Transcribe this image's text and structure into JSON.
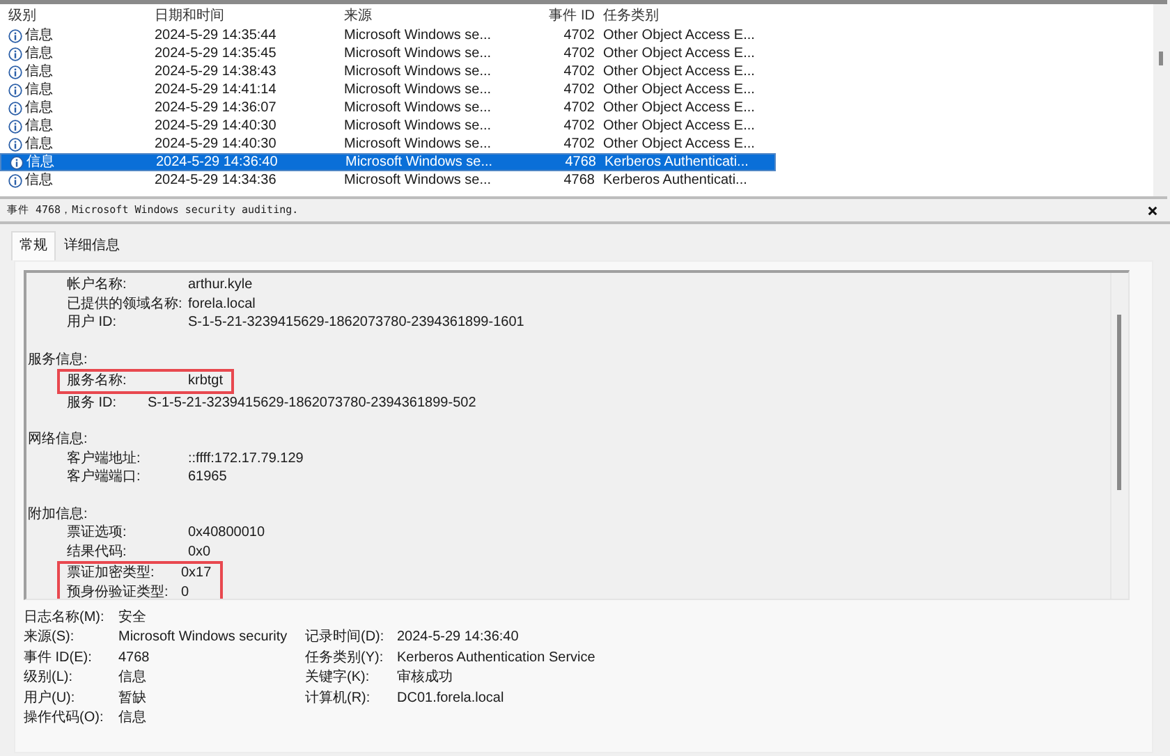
{
  "event_list": {
    "columns": [
      "级别",
      "日期和时间",
      "来源",
      "事件 ID",
      "任务类别"
    ],
    "rows": [
      {
        "level": "信息",
        "datetime": "2024-5-29 14:35:44",
        "source": "Microsoft Windows se...",
        "event_id": "4702",
        "task_category": "Other Object Access E...",
        "selected": false
      },
      {
        "level": "信息",
        "datetime": "2024-5-29 14:35:45",
        "source": "Microsoft Windows se...",
        "event_id": "4702",
        "task_category": "Other Object Access E...",
        "selected": false
      },
      {
        "level": "信息",
        "datetime": "2024-5-29 14:38:43",
        "source": "Microsoft Windows se...",
        "event_id": "4702",
        "task_category": "Other Object Access E...",
        "selected": false
      },
      {
        "level": "信息",
        "datetime": "2024-5-29 14:41:14",
        "source": "Microsoft Windows se...",
        "event_id": "4702",
        "task_category": "Other Object Access E...",
        "selected": false
      },
      {
        "level": "信息",
        "datetime": "2024-5-29 14:36:07",
        "source": "Microsoft Windows se...",
        "event_id": "4702",
        "task_category": "Other Object Access E...",
        "selected": false
      },
      {
        "level": "信息",
        "datetime": "2024-5-29 14:40:30",
        "source": "Microsoft Windows se...",
        "event_id": "4702",
        "task_category": "Other Object Access E...",
        "selected": false
      },
      {
        "level": "信息",
        "datetime": "2024-5-29 14:40:30",
        "source": "Microsoft Windows se...",
        "event_id": "4702",
        "task_category": "Other Object Access E...",
        "selected": false
      },
      {
        "level": "信息",
        "datetime": "2024-5-29 14:36:40",
        "source": "Microsoft Windows se...",
        "event_id": "4768",
        "task_category": "Kerberos Authenticati...",
        "selected": true
      },
      {
        "level": "信息",
        "datetime": "2024-5-29 14:34:36",
        "source": "Microsoft Windows se...",
        "event_id": "4768",
        "task_category": "Kerberos Authenticati...",
        "selected": false
      }
    ]
  },
  "detail": {
    "title": "事件 4768，Microsoft Windows security auditing.",
    "tabs": [
      {
        "label": "常规",
        "selected": true
      },
      {
        "label": "详细信息",
        "selected": false
      }
    ],
    "description": [
      {
        "fields": [
          {
            "label": "帐户名称:",
            "value": "arthur.kyle",
            "kind": "tabbed",
            "highlighted": false
          },
          {
            "label": "已提供的领域名称:",
            "value": "forela.local",
            "kind": "tabbed",
            "highlighted": false
          },
          {
            "label": "用户 ID:",
            "value": "S-1-5-21-3239415629-1862073780-2394361899-1601",
            "kind": "tabbed",
            "highlighted": false
          }
        ]
      },
      {
        "heading": "服务信息:",
        "fields": [
          {
            "label": "服务名称:",
            "value": "krbtgt",
            "kind": "tabbed",
            "highlighted": true
          },
          {
            "label": "服务 ID:",
            "value": "S-1-5-21-3239415629-1862073780-2394361899-502",
            "kind": "short",
            "highlighted": false
          }
        ]
      },
      {
        "heading": "网络信息:",
        "fields": [
          {
            "label": "客户端地址:",
            "value": "::ffff:172.17.79.129",
            "kind": "tabbed",
            "highlighted": false
          },
          {
            "label": "客户端端口:",
            "value": "61965",
            "kind": "tabbed",
            "highlighted": false
          }
        ]
      },
      {
        "heading": "附加信息:",
        "fields": [
          {
            "label": "票证选项:",
            "value": "0x40800010",
            "kind": "tabbed",
            "highlighted": false
          },
          {
            "label": "结果代码:",
            "value": "0x0",
            "kind": "tabbed",
            "highlighted": false
          },
          {
            "label": "票证加密类型:",
            "value": "0x17",
            "kind": "short",
            "highlighted": true
          },
          {
            "label": "预身份验证类型:",
            "value": "0",
            "kind": "short",
            "highlighted": true
          }
        ]
      }
    ],
    "properties": [
      [
        {
          "label": "日志名称(M):",
          "value": "安全"
        }
      ],
      [
        {
          "label": "来源(S):",
          "value": "Microsoft Windows security"
        },
        {
          "label": "记录时间(D):",
          "value": "2024-5-29 14:36:40"
        }
      ],
      [
        {
          "label": "事件 ID(E):",
          "value": "4768"
        },
        {
          "label": "任务类别(Y):",
          "value": "Kerberos Authentication Service"
        }
      ],
      [
        {
          "label": "级别(L):",
          "value": "信息"
        },
        {
          "label": "关键字(K):",
          "value": "审核成功"
        }
      ],
      [
        {
          "label": "用户(U):",
          "value": "暂缺"
        },
        {
          "label": "计算机(R):",
          "value": "DC01.forela.local"
        }
      ],
      [
        {
          "label": "操作代码(O):",
          "value": "信息"
        }
      ]
    ]
  }
}
